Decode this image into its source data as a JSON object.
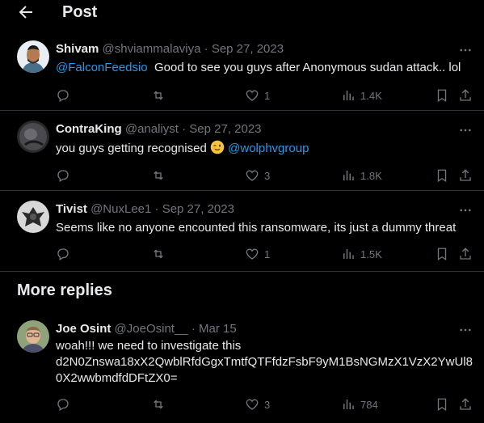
{
  "header": {
    "title": "Post"
  },
  "tweets": [
    {
      "name": "Shivam",
      "handle": "@shviammalaviya",
      "dot": "·",
      "date": "Sep 27, 2023",
      "mention": "@FalconFeedsio",
      "text": "Good to see you guys after Anonymous sudan  attack.. lol",
      "likes": "1",
      "views": "1.4K"
    },
    {
      "name": "ContraKing",
      "handle": "@analiyst",
      "dot": "·",
      "date": "Sep 27, 2023",
      "text": "you guys getting recognised",
      "emoji": "wink-emoji",
      "mention": "@wolphvgroup",
      "likes": "3",
      "views": "1.8K"
    },
    {
      "name": "Tivist",
      "handle": "@NuxLee1",
      "dot": "·",
      "date": "Sep 27, 2023",
      "text": "Seems like no anyone encounted this ransomware, its just a dummy threat",
      "likes": "1",
      "views": "1.5K"
    }
  ],
  "more_replies": {
    "title": "More replies"
  },
  "more_tweet": {
    "name": "Joe Osint",
    "handle": "@JoeOsint__",
    "dot": "·",
    "date": "Mar 15",
    "line1": "woah!!! we need to investigate this",
    "line2": "d2N0Znswa18xX2QwblRfdGgxTmtfQTFfdzFsbF9yM1BsNGMzX1VzX2YwUl8",
    "line3": "0X2wwbmdfdDFtZX0=",
    "likes": "3",
    "views": "784"
  },
  "icons": [
    "back-arrow-icon",
    "more-icon",
    "reply-icon",
    "repost-icon",
    "like-icon",
    "views-icon",
    "bookmark-icon",
    "share-icon"
  ],
  "colors": {
    "background": "#000000",
    "text": "#e7e9ea",
    "muted": "#71767b",
    "accent": "#1d9bf0",
    "divider": "#2f3336"
  }
}
